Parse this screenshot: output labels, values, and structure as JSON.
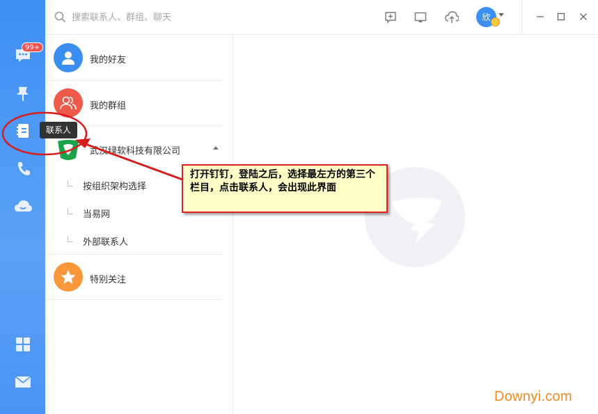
{
  "search": {
    "placeholder": "搜索联系人、群组、聊天"
  },
  "rail": {
    "badge": "99+"
  },
  "user": {
    "avatar_text": "欣"
  },
  "contacts": {
    "my_friends": "我的好友",
    "my_groups": "我的群组",
    "company": "武汉绿软科技有限公司",
    "sub_items": [
      "按组织架构选择",
      "当易网",
      "外部联系人"
    ],
    "special_attention": "特别关注"
  },
  "tooltip": {
    "contacts": "联系人"
  },
  "annotation": {
    "text": "打开钉钉，登陆之后，选择最左方的第三个栏目，点击联系人，会出现此界面"
  },
  "watermark": "Downyi.com",
  "colors": {
    "rail": "#4a93f4",
    "friends": "#3a8ef0",
    "groups": "#ee5a4a",
    "special": "#f7973a",
    "company_logo": "#1aa34a",
    "callout_border": "#e02020",
    "callout_bg": "#ffffc8"
  }
}
